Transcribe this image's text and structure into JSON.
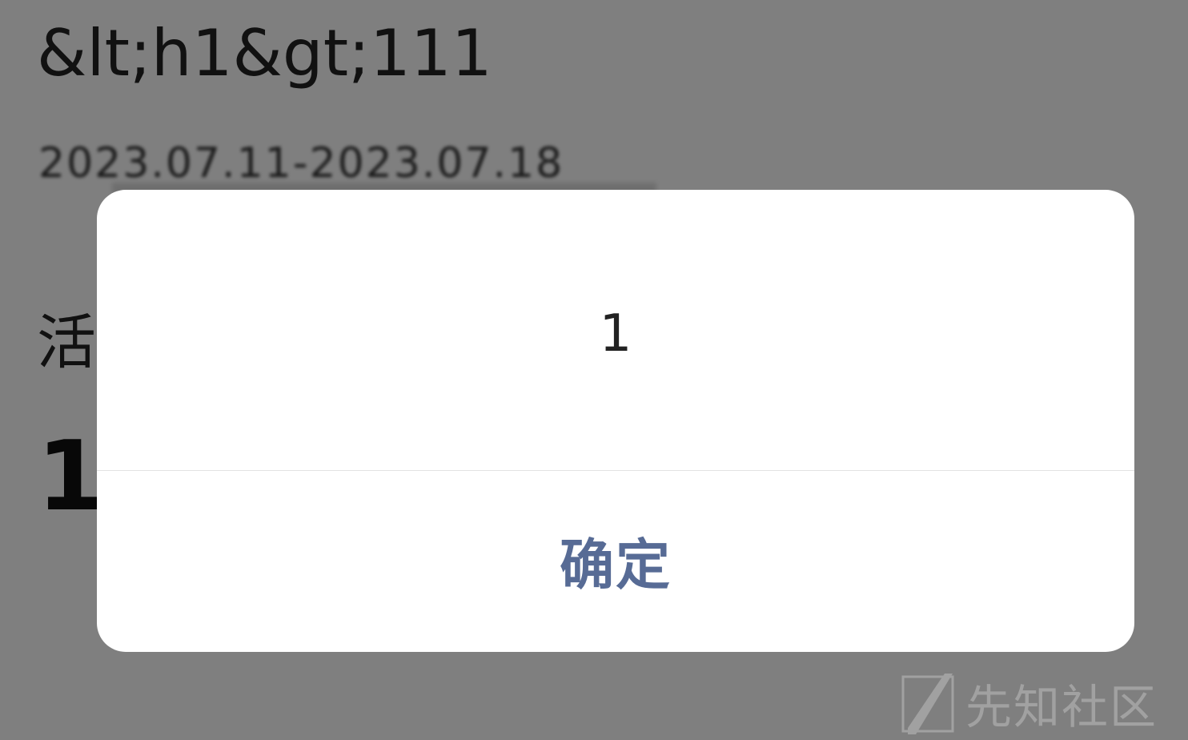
{
  "page": {
    "title": "&lt;h1&gt;111",
    "date_range": "2023.07.11-2023.07.18",
    "section_label": "活",
    "big_number": "1"
  },
  "dialog": {
    "message": "1",
    "confirm_label": "确定",
    "confirm_color": "#576b95"
  },
  "overlay": {
    "color": "#000000",
    "opacity": 0.5
  },
  "watermark": {
    "text": "先知社区",
    "icon": "xianzhi-logo-icon"
  }
}
